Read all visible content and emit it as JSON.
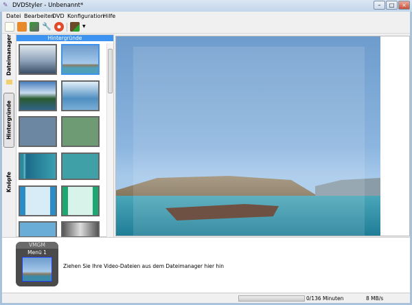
{
  "window": {
    "title": "DVDStyler - Unbenannt*"
  },
  "menu": [
    "Datei",
    "Bearbeiten",
    "DVD",
    "Konfiguration",
    "Hilfe"
  ],
  "toolbar": {
    "icons": [
      "new-icon",
      "open-icon",
      "save-icon",
      "settings-icon",
      "burn-icon",
      "add-file-icon"
    ]
  },
  "tabs": [
    "Dateimanager",
    "Hintergründe",
    "Knöpfe"
  ],
  "panel": {
    "title": "Hintergründe"
  },
  "titleset": {
    "vmgm": "VMGM",
    "menu": "Menü 1"
  },
  "drop_hint": "Ziehen Sie Ihre Video-Dateien aus dem Dateimanager hier hin",
  "status": {
    "progress_percent": 0,
    "duration": "0/136 Minuten",
    "bitrate": "8 MB/s"
  },
  "colors": {
    "accent": "#3d94f0"
  }
}
